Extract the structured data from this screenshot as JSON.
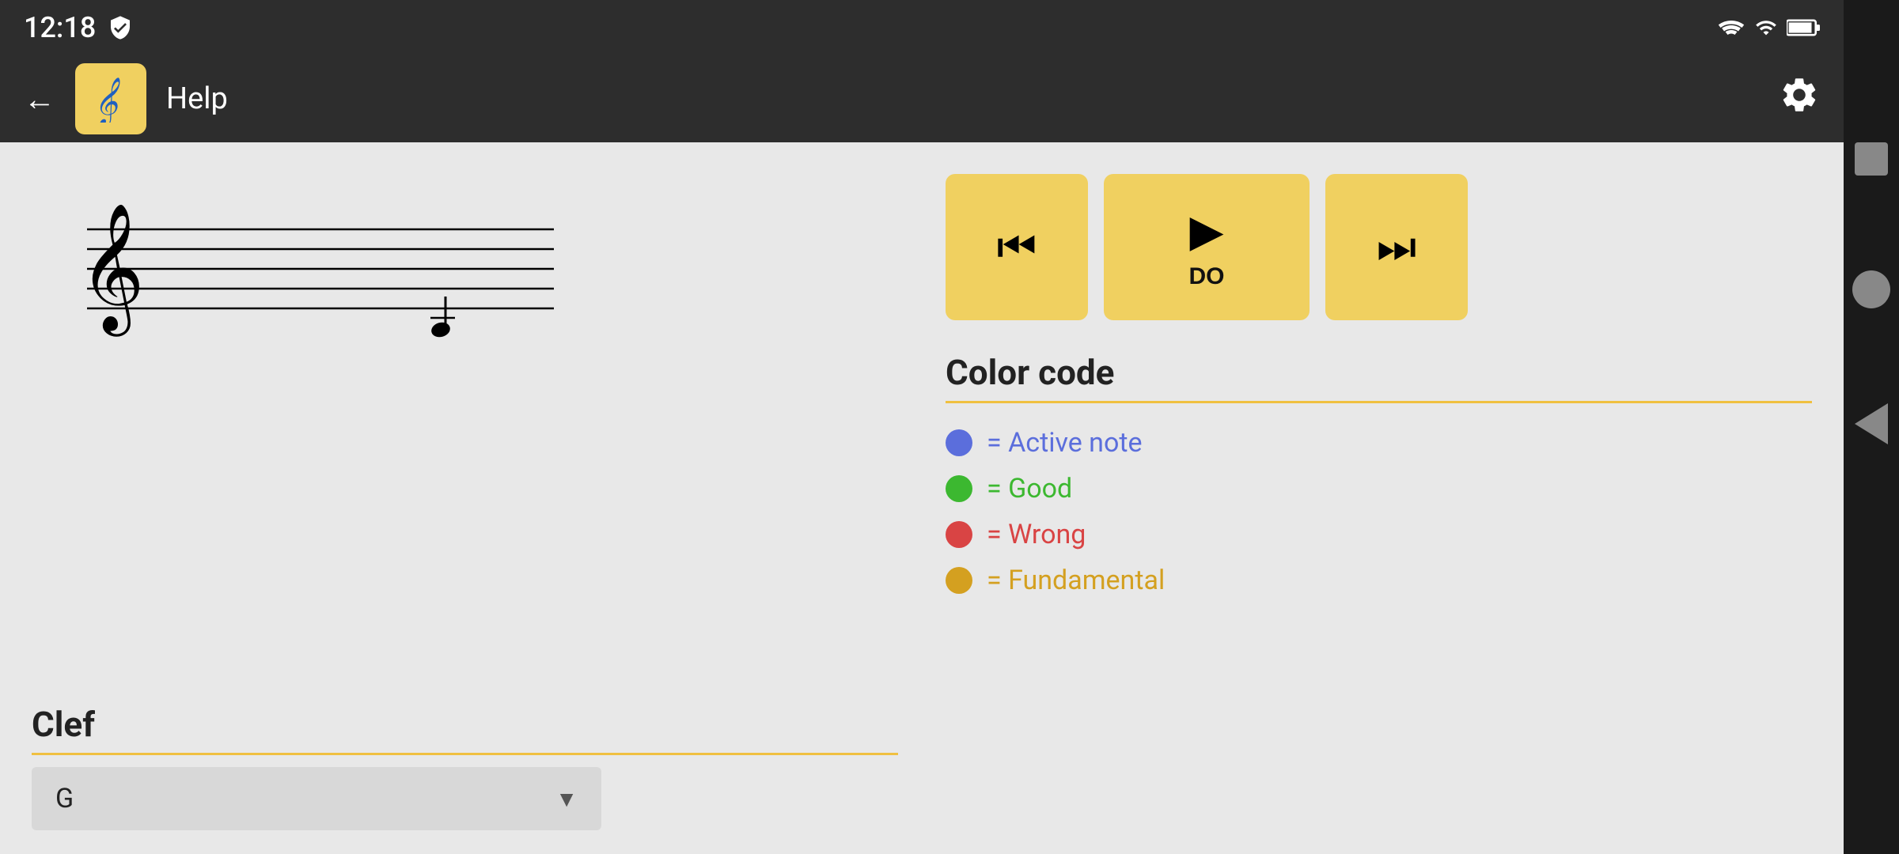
{
  "status_bar": {
    "time": "12:18",
    "shield_icon": "🛡"
  },
  "app_bar": {
    "title": "Help",
    "logo_icon": "♪",
    "back_label": "←",
    "settings_label": "⚙"
  },
  "left_panel": {
    "clef_section": {
      "title": "Clef",
      "dropdown_value": "G",
      "dropdown_arrow": "▼"
    }
  },
  "right_panel": {
    "playback": {
      "prev_icon": "⏮",
      "play_icon": "▶",
      "play_label": "DO",
      "next_icon": "⏭"
    },
    "color_code": {
      "title": "Color code",
      "items": [
        {
          "color": "#5b6edc",
          "label": "= Active note"
        },
        {
          "color": "#3cb830",
          "label": "= Good"
        },
        {
          "color": "#d94444",
          "label": "= Wrong"
        },
        {
          "color": "#d4a020",
          "label": "= Fundamental"
        }
      ]
    }
  }
}
